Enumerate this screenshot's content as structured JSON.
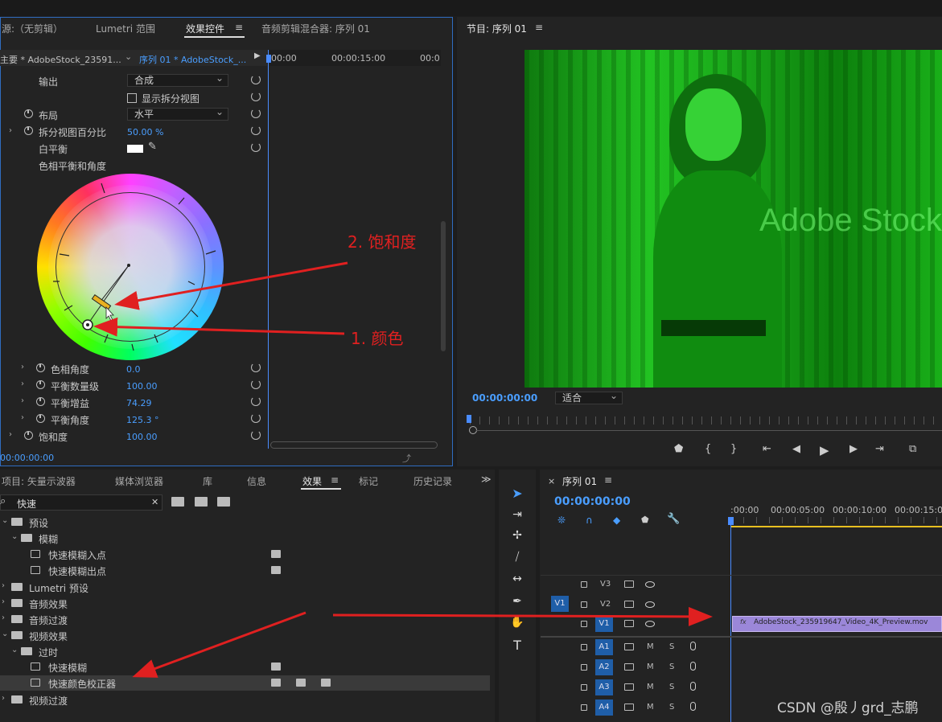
{
  "topbar": {
    "dark": true
  },
  "source_panel": {
    "tabs": [
      "源:（无剪辑）",
      "Lumetri 范围",
      "效果控件",
      "音频剪辑混合器: 序列 01"
    ],
    "active_tab": "效果控件",
    "menu_icon": "≡",
    "master_label": "主要 * AdobeStock_23591...",
    "sequence_label": "序列 01 * AdobeStock_...",
    "ruler": [
      "00:00",
      "00:00:15:00",
      "00:0"
    ],
    "rows": {
      "output_label": "输出",
      "output_value": "合成",
      "split_label": "显示拆分视图",
      "layout_label": "布局",
      "layout_value": "水平",
      "split_pct_label": "拆分视图百分比",
      "split_pct_value": "50.00 %",
      "wb_label": "白平衡",
      "hue_balance_label": "色相平衡和角度",
      "hue_angle_label": "色相角度",
      "hue_angle_value": "0.0",
      "balance_mag_label": "平衡数量级",
      "balance_mag_value": "100.00",
      "balance_gain_label": "平衡增益",
      "balance_gain_value": "74.29",
      "balance_angle_label": "平衡角度",
      "balance_angle_value": "125.3 °",
      "saturation_label": "饱和度",
      "saturation_value": "100.00"
    },
    "timecode": "00:00:00:00"
  },
  "annotations": {
    "label1": "2. 饱和度",
    "label2": "1. 颜色",
    "accent": "#e02020"
  },
  "program": {
    "title": "节目: 序列 01",
    "menu": "≡",
    "timecode": "00:00:00:00",
    "fit": "适合",
    "watermark": "Adobe Stock",
    "tint": "#16c016"
  },
  "effects_panel": {
    "tabs": [
      "项目: 矢量示波器",
      "媒体浏览器",
      "库",
      "信息",
      "效果",
      "标记",
      "历史记录"
    ],
    "active_tab": "效果",
    "menu": "≡",
    "expand": "≫",
    "search_value": "快速",
    "search_clear": "✕",
    "tree": [
      {
        "label": "预设",
        "indent": 0,
        "type": "preset-folder",
        "open": true
      },
      {
        "label": "模糊",
        "indent": 1,
        "type": "preset-folder",
        "open": true
      },
      {
        "label": "快速模糊入点",
        "indent": 2,
        "type": "preset"
      },
      {
        "label": "快速模糊出点",
        "indent": 2,
        "type": "preset"
      },
      {
        "label": "Lumetri 预设",
        "indent": 0,
        "type": "preset-folder",
        "open": false
      },
      {
        "label": "音频效果",
        "indent": 0,
        "type": "folder",
        "open": false
      },
      {
        "label": "音频过渡",
        "indent": 0,
        "type": "folder",
        "open": false
      },
      {
        "label": "视频效果",
        "indent": 0,
        "type": "folder",
        "open": true
      },
      {
        "label": "过时",
        "indent": 1,
        "type": "folder",
        "open": true
      },
      {
        "label": "快速模糊",
        "indent": 2,
        "type": "effect"
      },
      {
        "label": "快速颜色校正器",
        "indent": 2,
        "type": "effect",
        "selected": true
      },
      {
        "label": "视频过渡",
        "indent": 0,
        "type": "folder",
        "open": false
      }
    ]
  },
  "timeline": {
    "close": "×",
    "title": "序列 01",
    "menu": "≡",
    "timecode": "00:00:00:00",
    "ruler": [
      ":00:00",
      "00:00:05:00",
      "00:00:10:00",
      "00:00:15:00"
    ],
    "tracks": [
      "V3",
      "V2",
      "V1",
      "A1",
      "A2",
      "A3",
      "A4"
    ],
    "src_patch": "V1",
    "mute": "M",
    "solo": "S",
    "clip": "AdobeStock_235919647_Video_4K_Preview.mov",
    "clip_fx": "fx"
  },
  "watermark": "CSDN @殷丿grd_志鹏"
}
